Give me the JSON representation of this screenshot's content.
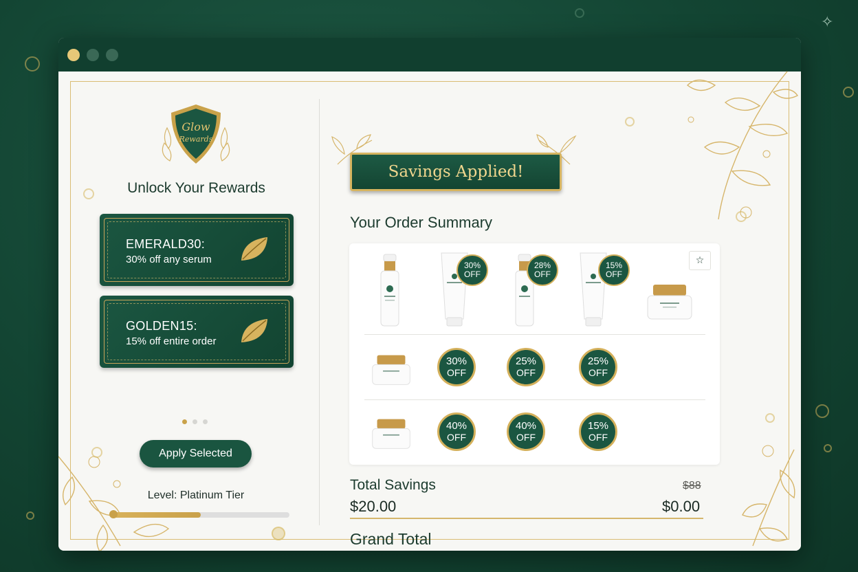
{
  "window": {
    "controls": [
      "close",
      "minimize",
      "maximize"
    ]
  },
  "rewards": {
    "badge_text_line1": "Glow",
    "badge_text_line2": "Rewards",
    "title": "Unlock Your Rewards",
    "coupons": [
      {
        "code": "EMERALD30:",
        "description": "30% off any serum",
        "icon": "leaf-icon"
      },
      {
        "code": "GOLDEN15:",
        "description": "15% off entire order",
        "icon": "leaf-icon"
      }
    ],
    "pager": {
      "pages": 3,
      "active": 1
    },
    "apply_label": "Apply Selected",
    "level_label": "Level: Platinum Tier",
    "level_progress": 0.5
  },
  "order": {
    "banner": "Savings Applied!",
    "title": "Your Order Summary",
    "star_icon": "star-icon",
    "row1": [
      {
        "type": "serum",
        "discount": null
      },
      {
        "type": "tube",
        "discount": {
          "pct": "30%",
          "off": "OFF"
        }
      },
      {
        "type": "serum",
        "discount": {
          "pct": "28%",
          "off": "OFF"
        }
      },
      {
        "type": "tube",
        "discount": {
          "pct": "15%",
          "off": "OFF"
        }
      },
      {
        "type": "jar",
        "discount": null
      }
    ],
    "row2": [
      {
        "type": "jar"
      },
      {
        "pct": "30%",
        "off": "OFF"
      },
      {
        "pct": "25%",
        "off": "OFF"
      },
      {
        "pct": "25%",
        "off": "OFF"
      }
    ],
    "row3": [
      {
        "type": "jar"
      },
      {
        "pct": "40%",
        "off": "OFF"
      },
      {
        "pct": "40%",
        "off": "OFF"
      },
      {
        "pct": "15%",
        "off": "OFF"
      }
    ],
    "total_savings_label": "Total Savings",
    "original_price": "$88",
    "savings_amount": "$20.00",
    "grand_total_amount": "$0.00",
    "grand_total_label": "Grand Total"
  },
  "colors": {
    "brand_green": "#1b5641",
    "gold": "#d4b05b",
    "background": "#134533"
  }
}
